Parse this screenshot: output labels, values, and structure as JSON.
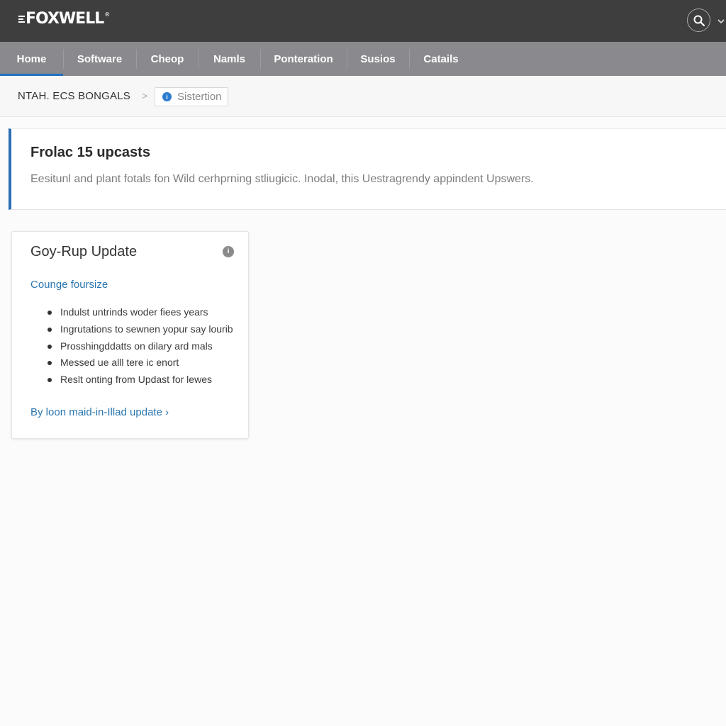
{
  "header": {
    "logo_text": "FOXWELL",
    "logo_mark": "®",
    "search_icon": "search-icon",
    "menu_chevron": "chevron-down-icon"
  },
  "nav": {
    "items": [
      {
        "label": "Home",
        "active": true
      },
      {
        "label": "Software",
        "active": false
      },
      {
        "label": "Cheop",
        "active": false
      },
      {
        "label": "Namls",
        "active": false
      },
      {
        "label": "Ponteration",
        "active": false
      },
      {
        "label": "Susios",
        "active": false
      },
      {
        "label": "Catails",
        "active": false
      }
    ],
    "active_color": "#1f6fc0"
  },
  "breadcrumb": {
    "root": "NTAH. ECS BONGALS",
    "separator": ">",
    "current": "Sistertion",
    "current_icon": "info-dot-icon"
  },
  "banner": {
    "title": "Frolac 15 upcasts",
    "description": "Eesitunl and plant fotals fon Wild cerhprning stliugicic. Inodal, this Uestragrendy appindent Upswers.",
    "accent_color": "#2a6fb5"
  },
  "card": {
    "title": "Goy-Rup Update",
    "info_icon": "info-icon",
    "subtitle": "Counge foursize",
    "bullets": [
      "Indulst untrinds woder fiees years",
      "Ingrutations to sewnen yopur say lourib",
      "Prosshingddatts on dilary ard mals",
      "Messed ue alll tere ic enort",
      "Reslt onting from Updast for lewes"
    ],
    "link": "By loon maid-in-Illad update ›",
    "link_color": "#2a76b0"
  }
}
